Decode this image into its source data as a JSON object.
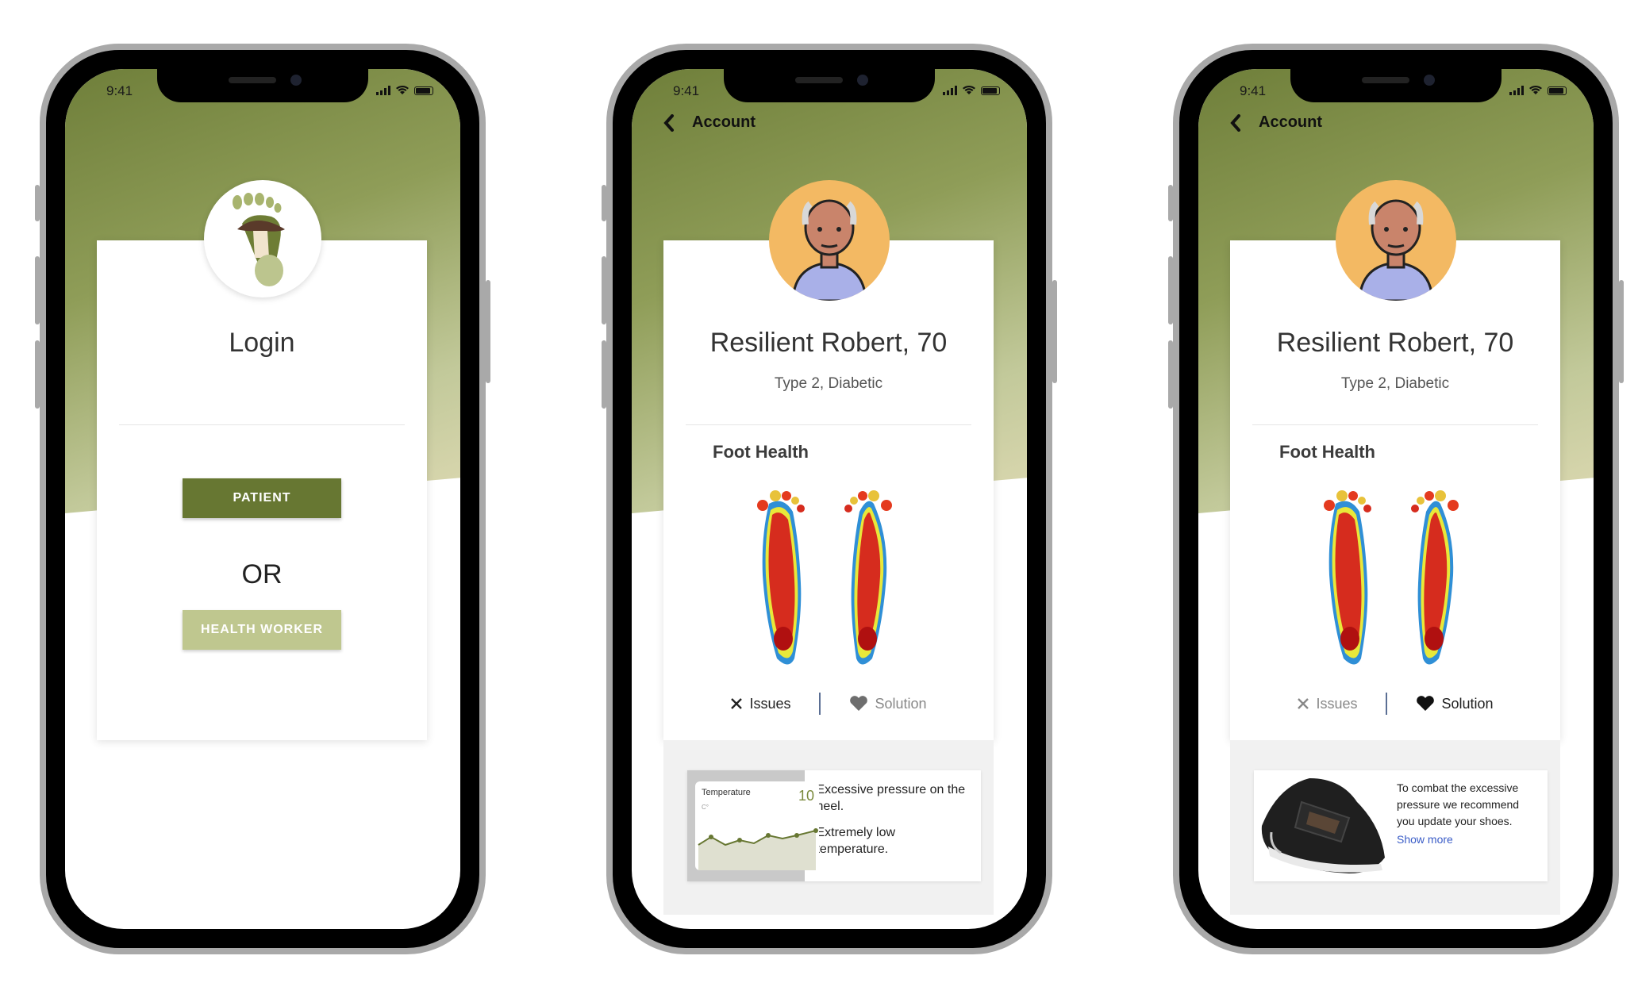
{
  "status_bar": {
    "time": "9:41"
  },
  "screen_login": {
    "title": "Login",
    "patient_button": "PATIENT",
    "or_text": "OR",
    "health_worker_button": "HEALTH WORKER"
  },
  "screen_issues": {
    "back_label": "Account",
    "name": "Resilient Robert, 70",
    "condition": "Type 2, Diabetic",
    "section_title": "Foot Health",
    "tab_issues": "Issues",
    "tab_solution": "Solution",
    "active_tab": "issues",
    "chart": {
      "label": "Temperature",
      "unit": "C°",
      "value": "10"
    },
    "issue_1": "Excessive pressure on the heel.",
    "issue_2": "Extremely low temperature."
  },
  "screen_solution": {
    "back_label": "Account",
    "name": "Resilient Robert, 70",
    "condition": "Type 2, Diabetic",
    "section_title": "Foot Health",
    "tab_issues": "Issues",
    "tab_solution": "Solution",
    "active_tab": "solution",
    "solution_text": "To combat the excessive pressure we recommend you update your shoes.",
    "show_more": "Show more"
  },
  "colors": {
    "brand_dark": "#677732",
    "brand_light": "#bfc78f",
    "avatar_bg": "#f3b963",
    "link": "#3a5cc7"
  },
  "icons": [
    "back-chevron-icon",
    "close-x-icon",
    "heart-icon",
    "signal-icon",
    "wifi-icon",
    "battery-icon"
  ]
}
